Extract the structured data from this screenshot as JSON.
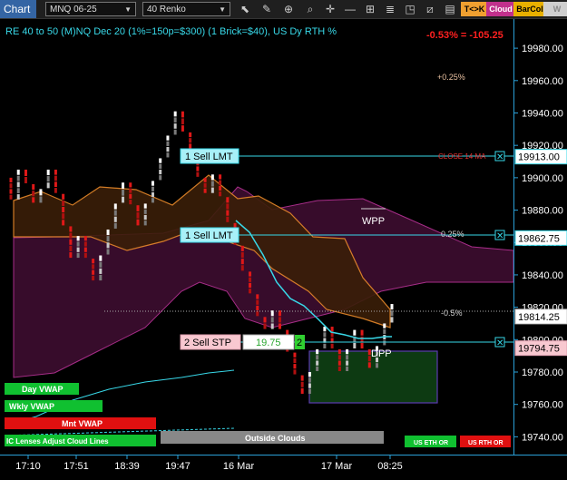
{
  "toolbar": {
    "chart_tab": "Chart",
    "instrument": "MNQ 06-25",
    "bar_type": "40 Renko",
    "icons": [
      "pencil-icon",
      "magnifier-icon",
      "zoom-in-icon",
      "crosshair-icon",
      "horizontal-line-icon",
      "grid-icon",
      "stack-icon",
      "shapes-icon",
      "slash-icon",
      "bar-icon"
    ],
    "tag_tk": "T<>K",
    "tag_cloud": "Cloud",
    "tag_barcol": "BarCol",
    "tag_vvv": "W VVV",
    "colors": {
      "tk": "#f0a030",
      "cloud": "#c1308c",
      "barcol": "#e8b000",
      "vvv": "#cfcfcf"
    }
  },
  "header": {
    "title": "RE 40 to 50 (M)NQ Dec 20 (1%=150p=$300) (1 Brick=$40), US Dy RTH %",
    "pnl": "-0.53% = -105.25"
  },
  "chart_data": {
    "type": "renko",
    "ylim": [
      19729,
      19998
    ],
    "y_ticks": [
      "19980.00",
      "19960.00",
      "19940.00",
      "19920.00",
      "19900.00",
      "19880.00",
      "19860.00",
      "19840.00",
      "19820.00",
      "19800.00",
      "19780.00",
      "19760.00",
      "19740.00"
    ],
    "x_ticks": [
      "17:10",
      "17:51",
      "18:39",
      "19:47",
      "16 Mar",
      "17 Mar",
      "08:25"
    ],
    "levels": [
      {
        "name": "1 Sell LMT",
        "price": "19913.00",
        "value": 19913
      },
      {
        "name": "1 Sell LMT",
        "price": "19862.75",
        "value": 19862.75
      },
      {
        "name": "2 Sell STP",
        "price": "19794.75",
        "value": 19794.75,
        "fill": "19.75",
        "qty": "2"
      }
    ],
    "last_price": {
      "price": "19814.25",
      "value": 19814.25
    },
    "pct_labels": [
      "+0.25%",
      "0.25%",
      "-0.5%"
    ],
    "annotations": [
      "CLOSE 14 MA",
      "WPP",
      "DPP",
      "Outside Clouds"
    ],
    "legend_buttons": [
      "Day VWAP",
      "Wkly VWAP",
      "Mnt VWAP",
      "IC Lenses Adjust Cloud Lines",
      "US ETH OR",
      "US RTH OR"
    ],
    "bricks": [
      {
        "t": 0,
        "close": 19886,
        "color": "red"
      },
      {
        "t": 1,
        "close": 19905,
        "color": "white"
      },
      {
        "t": 2,
        "close": 19896,
        "color": "red"
      },
      {
        "t": 3,
        "close": 19884,
        "color": "red"
      },
      {
        "t": 4,
        "close": 19893,
        "color": "white"
      },
      {
        "t": 5,
        "close": 19905,
        "color": "white"
      },
      {
        "t": 6,
        "close": 19890,
        "color": "red"
      },
      {
        "t": 7,
        "close": 19870,
        "color": "red"
      },
      {
        "t": 8,
        "close": 19850,
        "color": "red"
      },
      {
        "t": 9,
        "close": 19864,
        "color": "white"
      },
      {
        "t": 10,
        "close": 19850,
        "color": "red"
      },
      {
        "t": 11,
        "close": 19836,
        "color": "red"
      },
      {
        "t": 12,
        "close": 19852,
        "color": "white"
      },
      {
        "t": 13,
        "close": 19868,
        "color": "white"
      },
      {
        "t": 14,
        "close": 19884,
        "color": "white"
      },
      {
        "t": 15,
        "close": 19897,
        "color": "white"
      },
      {
        "t": 16,
        "close": 19883,
        "color": "red"
      },
      {
        "t": 17,
        "close": 19870,
        "color": "red"
      },
      {
        "t": 18,
        "close": 19884,
        "color": "white"
      },
      {
        "t": 19,
        "close": 19898,
        "color": "white"
      },
      {
        "t": 20,
        "close": 19912,
        "color": "white"
      },
      {
        "t": 21,
        "close": 19926,
        "color": "white"
      },
      {
        "t": 22,
        "close": 19941,
        "color": "white"
      },
      {
        "t": 23,
        "close": 19928,
        "color": "red"
      },
      {
        "t": 24,
        "close": 19914,
        "color": "red"
      },
      {
        "t": 25,
        "close": 19900,
        "color": "red"
      },
      {
        "t": 26,
        "close": 19890,
        "color": "red"
      },
      {
        "t": 27,
        "close": 19902,
        "color": "white"
      },
      {
        "t": 28,
        "close": 19888,
        "color": "red"
      },
      {
        "t": 29,
        "close": 19872,
        "color": "red"
      },
      {
        "t": 30,
        "close": 19858,
        "color": "red"
      },
      {
        "t": 31,
        "close": 19842,
        "color": "red"
      },
      {
        "t": 32,
        "close": 19828,
        "color": "red"
      },
      {
        "t": 33,
        "close": 19814,
        "color": "red"
      },
      {
        "t": 34,
        "close": 19806,
        "color": "red"
      },
      {
        "t": 35,
        "close": 19818,
        "color": "white"
      },
      {
        "t": 36,
        "close": 19806,
        "color": "red"
      },
      {
        "t": 37,
        "close": 19792,
        "color": "red"
      },
      {
        "t": 38,
        "close": 19778,
        "color": "red"
      },
      {
        "t": 39,
        "close": 19766,
        "color": "red"
      },
      {
        "t": 40,
        "close": 19780,
        "color": "white"
      },
      {
        "t": 41,
        "close": 19794,
        "color": "white"
      },
      {
        "t": 42,
        "close": 19808,
        "color": "white"
      },
      {
        "t": 43,
        "close": 19794,
        "color": "red"
      },
      {
        "t": 44,
        "close": 19780,
        "color": "red"
      },
      {
        "t": 45,
        "close": 19794,
        "color": "white"
      },
      {
        "t": 46,
        "close": 19806,
        "color": "white"
      },
      {
        "t": 47,
        "close": 19794,
        "color": "red"
      },
      {
        "t": 48,
        "close": 19782,
        "color": "red"
      },
      {
        "t": 49,
        "close": 19796,
        "color": "white"
      },
      {
        "t": 50,
        "close": 19810,
        "color": "white"
      },
      {
        "t": 51,
        "close": 19822,
        "color": "white"
      }
    ]
  }
}
